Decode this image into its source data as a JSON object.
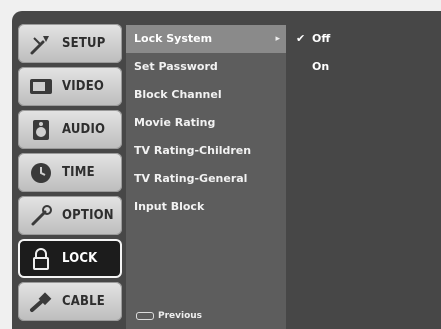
{
  "tabs": [
    {
      "label": "SETUP",
      "icon": "setup-wrench-icon"
    },
    {
      "label": "VIDEO",
      "icon": "video-tv-icon"
    },
    {
      "label": "AUDIO",
      "icon": "audio-speaker-icon"
    },
    {
      "label": "TIME",
      "icon": "time-clock-icon"
    },
    {
      "label": "OPTION",
      "icon": "option-tool-icon"
    },
    {
      "label": "LOCK",
      "icon": "lock-padlock-icon",
      "active": true
    },
    {
      "label": "CABLE",
      "icon": "cable-icon"
    }
  ],
  "submenu": {
    "items": [
      {
        "label": "Lock System",
        "selected": true
      },
      {
        "label": "Set Password"
      },
      {
        "label": "Block Channel"
      },
      {
        "label": "Movie Rating"
      },
      {
        "label": "TV Rating-Children"
      },
      {
        "label": "TV Rating-General"
      },
      {
        "label": "Input Block"
      }
    ],
    "arrow": "▸",
    "previous_label": "Previous"
  },
  "options": {
    "items": [
      {
        "label": "Off",
        "checked": true
      },
      {
        "label": "On",
        "checked": false
      }
    ],
    "check_glyph": "✔"
  },
  "colors": {
    "panel": "#474747",
    "submenu": "#5d5d5d",
    "selected_row": "#8a8a8a",
    "active_tab": "#1c1c1c"
  }
}
